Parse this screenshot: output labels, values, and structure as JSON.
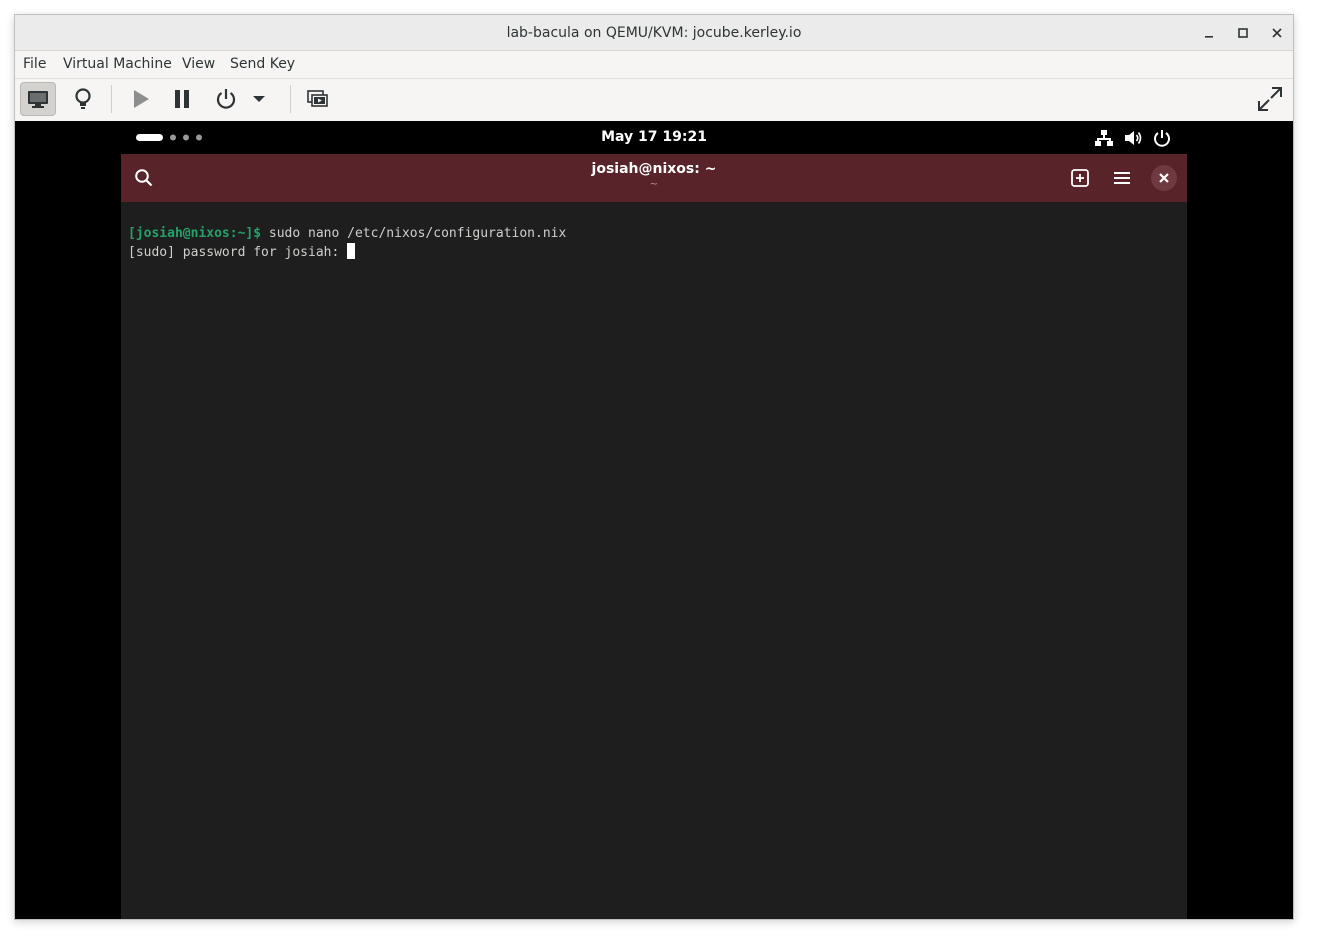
{
  "window": {
    "title": "lab-bacula on QEMU/KVM: jocube.kerley.io",
    "controls": [
      "minimize-icon",
      "maximize-icon",
      "close-icon"
    ]
  },
  "menubar": {
    "items": [
      {
        "label": "File"
      },
      {
        "label": "Virtual Machine"
      },
      {
        "label": "View"
      },
      {
        "label": "Send Key"
      }
    ]
  },
  "toolbar": {
    "buttons": [
      "console-icon",
      "details-bulb-icon",
      "run-icon",
      "pause-icon",
      "power-icon",
      "dropdown-arrow-icon",
      "snapshots-icon",
      "fullscreen-icon"
    ],
    "active": "console-icon"
  },
  "guest": {
    "topbar": {
      "clock": "May 17  19:21",
      "workspaces": 4,
      "active_workspace": 1,
      "status_icons": [
        "network-icon",
        "volume-icon",
        "power-icon"
      ]
    },
    "terminal": {
      "title": "josiah@nixos: ~",
      "subtitle": "~",
      "header_colors": {
        "background": "#58242a",
        "prompt": "#26a269"
      },
      "lines": [
        {
          "prompt": "[josiah@nixos:~]$",
          "command": " sudo nano /etc/nixos/configuration.nix"
        },
        {
          "text": "[sudo] password for josiah: "
        }
      ]
    }
  }
}
